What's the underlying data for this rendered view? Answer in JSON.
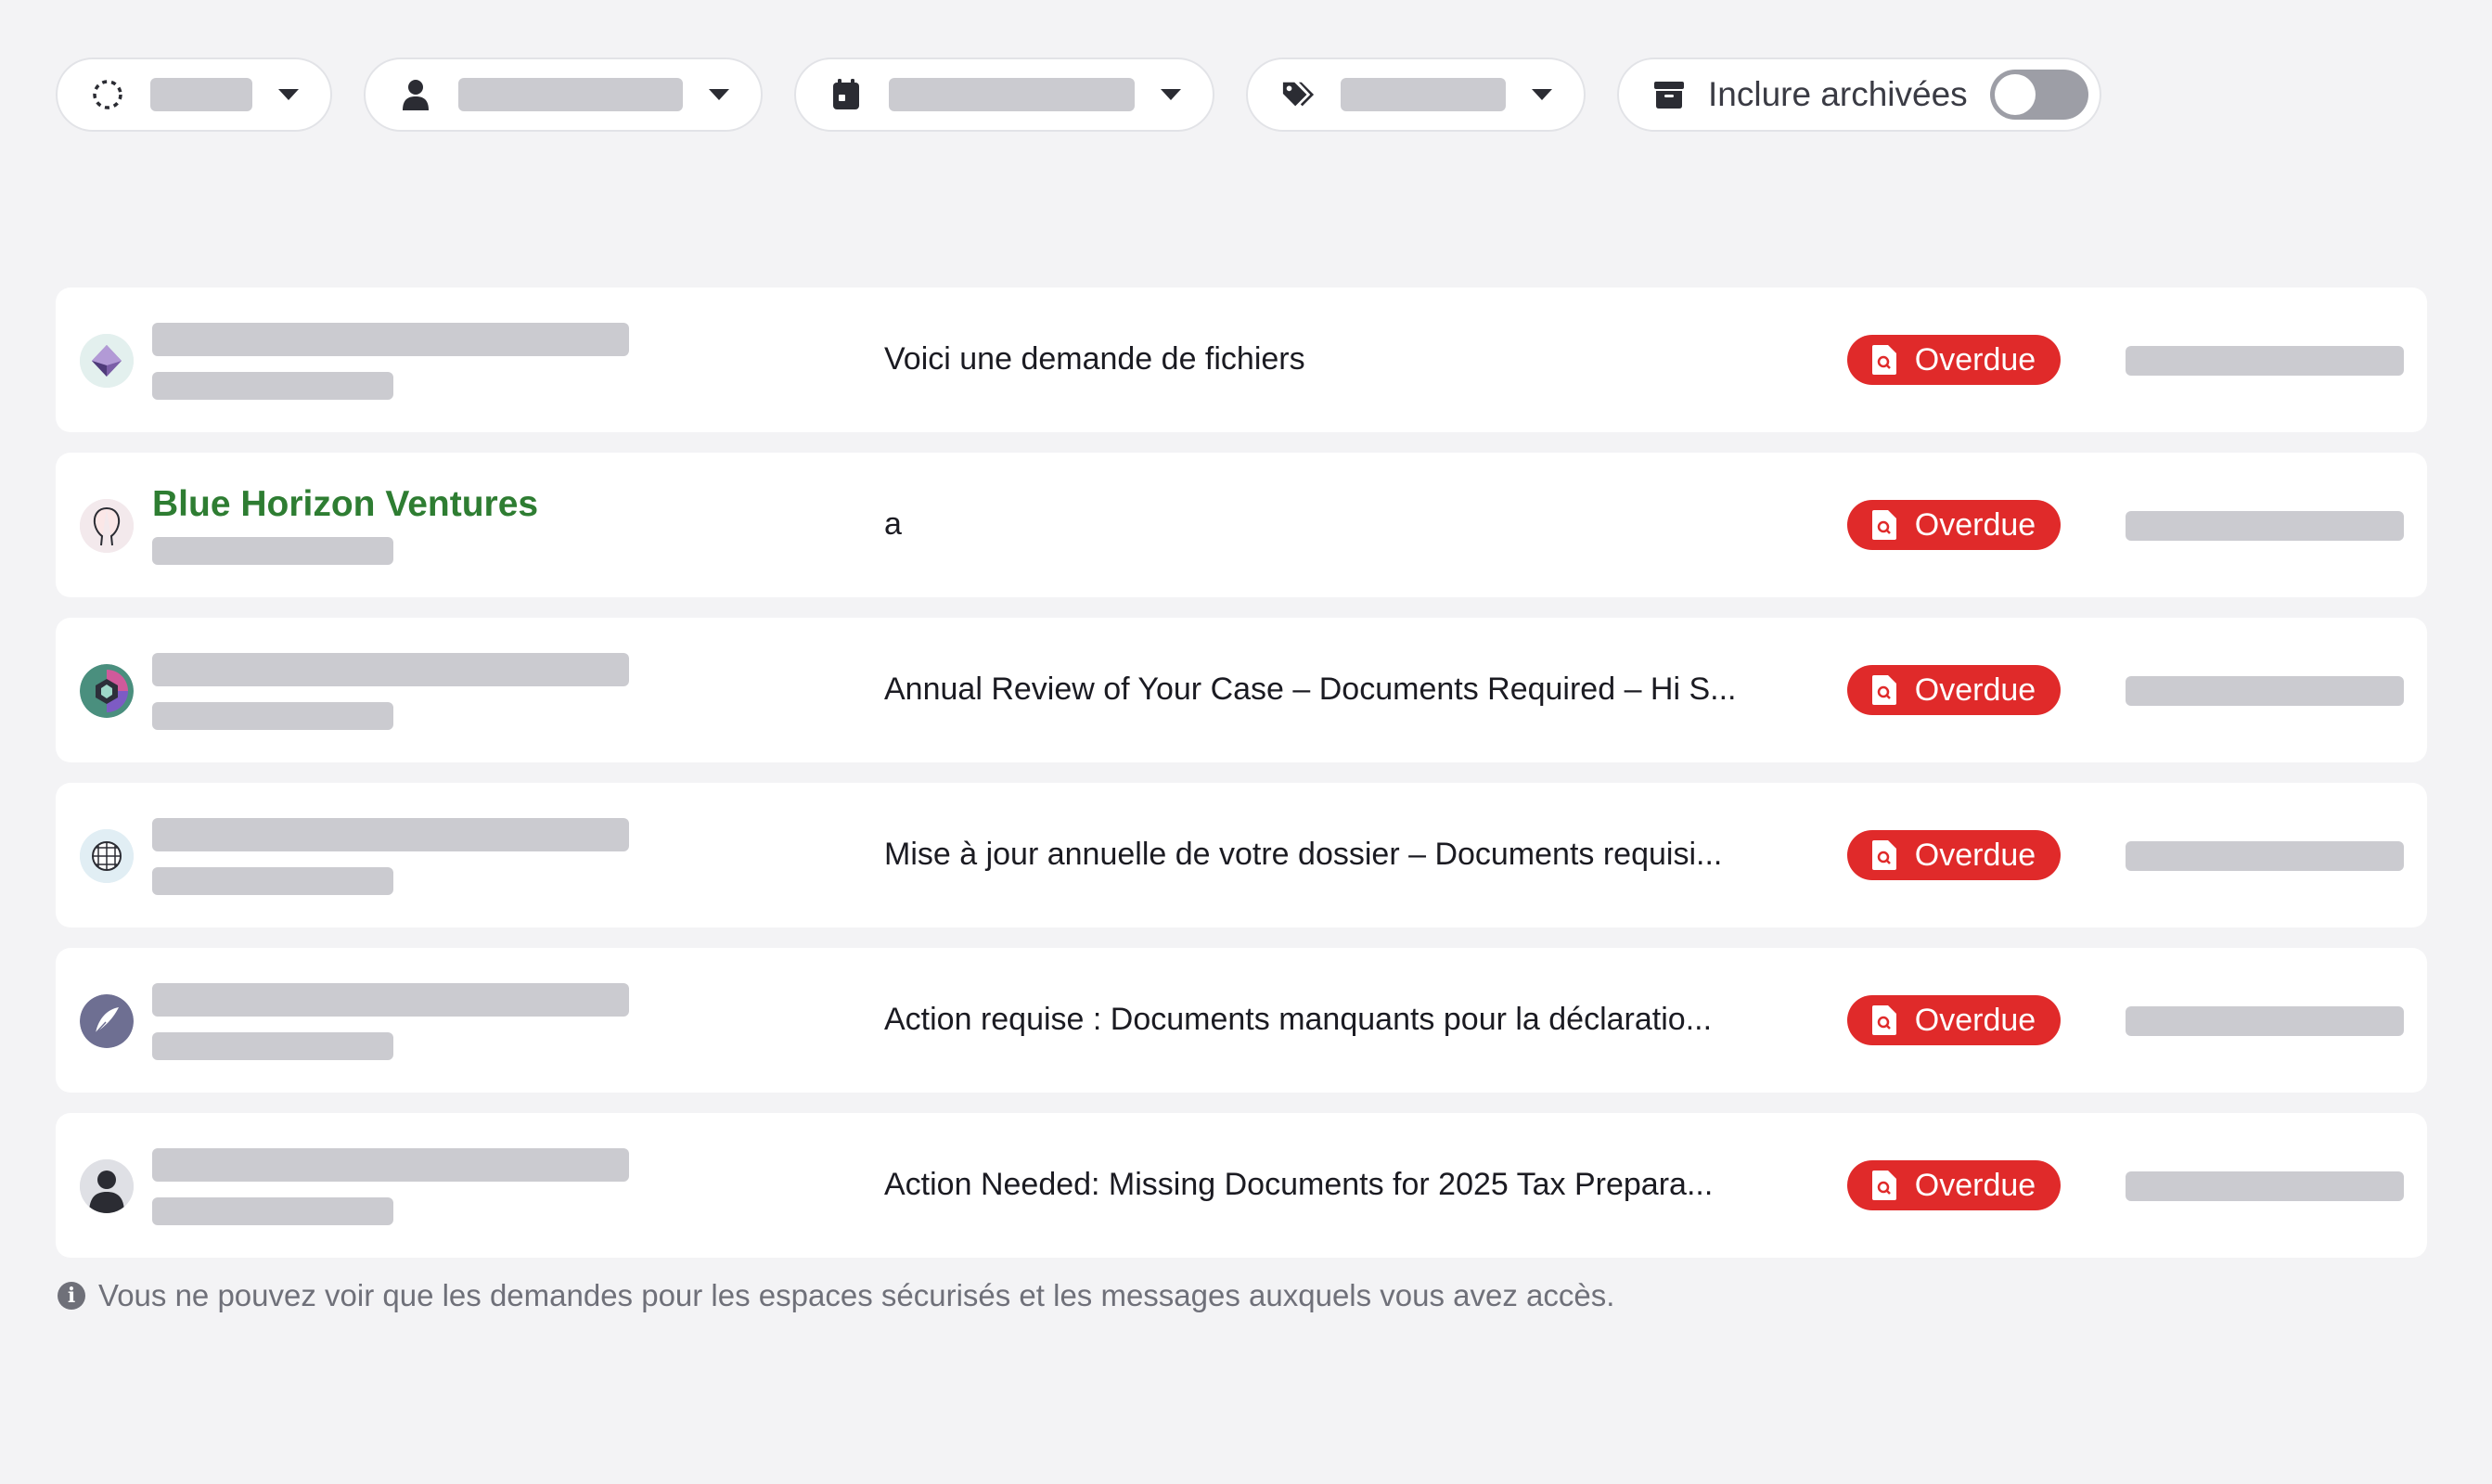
{
  "filters": {
    "status": {
      "icon": "dashed-circle-icon"
    },
    "assignee": {
      "icon": "user-icon"
    },
    "date": {
      "icon": "calendar-icon"
    },
    "tags": {
      "icon": "tags-icon"
    },
    "archive": {
      "icon": "archive-box-icon",
      "label": "Inclure archivées",
      "checked": false
    }
  },
  "rows": [
    {
      "avatar": "purple-diamond-logo",
      "org_name": "",
      "subject": "Voici une demande de fichiers",
      "status": "Overdue"
    },
    {
      "avatar": "face-outline-avatar",
      "org_name": "Blue Horizon Ventures",
      "subject": "a",
      "status": "Overdue"
    },
    {
      "avatar": "gradient-hexagon-logo",
      "org_name": "",
      "subject": "Annual Review of Your Case – Documents Required – Hi S...",
      "status": "Overdue"
    },
    {
      "avatar": "lattice-globe-logo",
      "org_name": "",
      "subject": "Mise à jour annuelle de votre dossier – Documents requisi...",
      "status": "Overdue"
    },
    {
      "avatar": "feather-pen-logo",
      "org_name": "",
      "subject": "Action requise : Documents manquants pour la déclaratio...",
      "status": "Overdue"
    },
    {
      "avatar": "person-silhouette-avatar",
      "org_name": "",
      "subject": "Action Needed: Missing Documents for 2025 Tax Prepara...",
      "status": "Overdue"
    }
  ],
  "status_color": "#e02a2a",
  "org_name_color": "#2e7d32",
  "footer_note": "Vous ne pouvez voir que les demandes pour les espaces sécurisés et les messages auxquels vous avez accès."
}
